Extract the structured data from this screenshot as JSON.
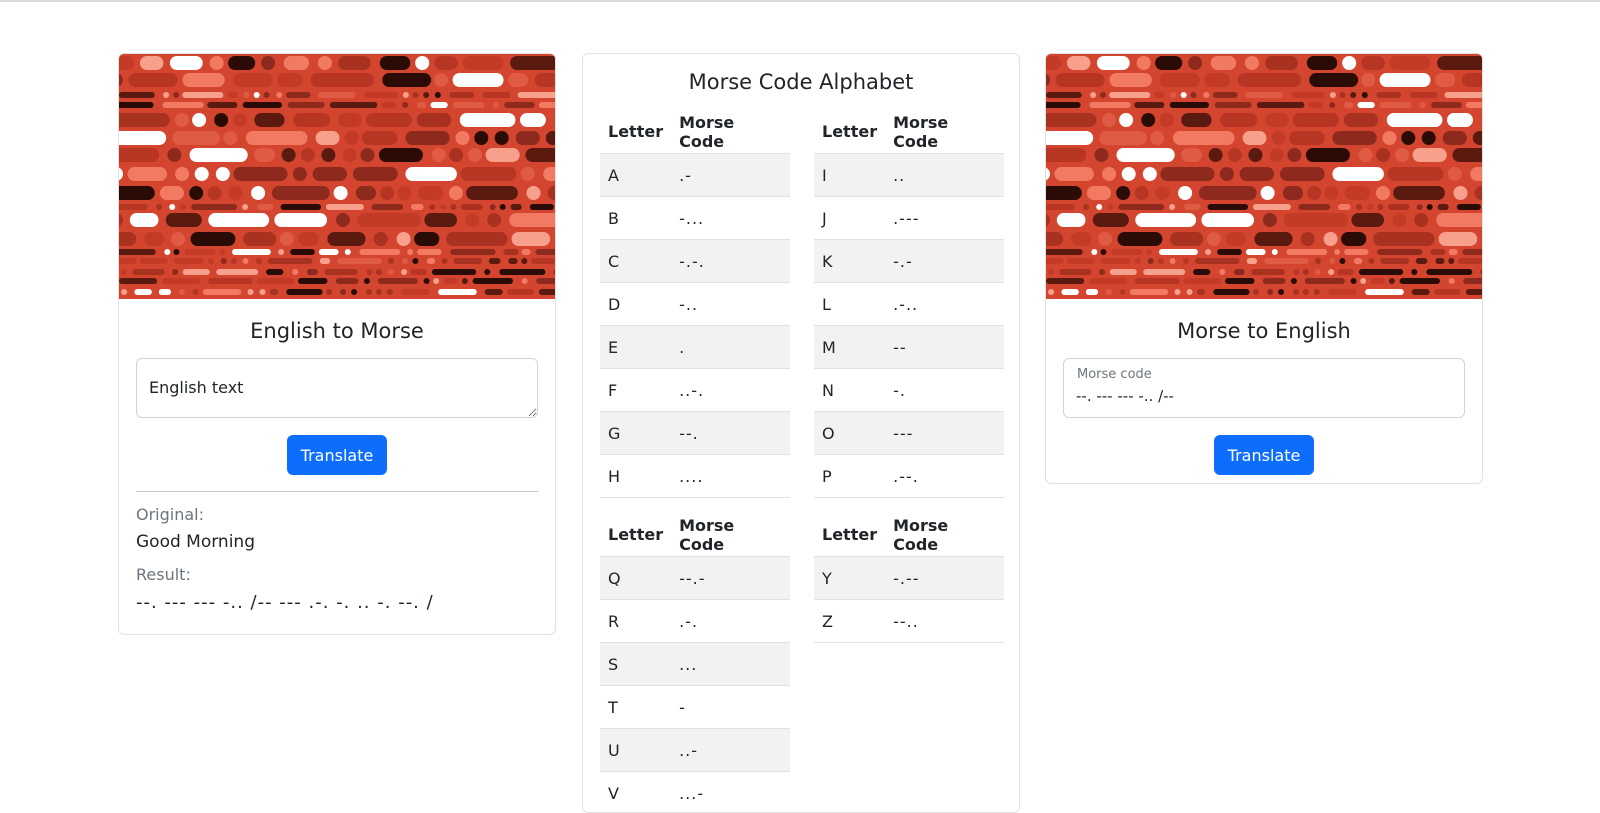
{
  "colors": {
    "accent": "#0d6efd",
    "banner_base": "#d4452f",
    "muted": "#6c757d"
  },
  "left": {
    "title": "English to Morse",
    "input_value": "English text",
    "button_label": "Translate",
    "original_label": "Original:",
    "original_value": "Good Morning",
    "result_label": "Result:",
    "result_value": "--. --- --- -.. /-- --- .-. -. .. -. --. /"
  },
  "middle": {
    "title": "Morse Code Alphabet",
    "header_letter": "Letter",
    "header_code": "Morse Code",
    "tables": [
      {
        "rows": [
          [
            "A",
            ".-"
          ],
          [
            "B",
            "-..."
          ],
          [
            "C",
            "-.-."
          ],
          [
            "D",
            "-.."
          ],
          [
            "E",
            "."
          ],
          [
            "F",
            "..-."
          ],
          [
            "G",
            "--."
          ],
          [
            "H",
            "...."
          ]
        ]
      },
      {
        "rows": [
          [
            "I",
            ".."
          ],
          [
            "J",
            ".---"
          ],
          [
            "K",
            "-.-"
          ],
          [
            "L",
            ".-.."
          ],
          [
            "M",
            "--"
          ],
          [
            "N",
            "-."
          ],
          [
            "O",
            "---"
          ],
          [
            "P",
            ".--."
          ]
        ]
      },
      {
        "rows": [
          [
            "Q",
            "--.-"
          ],
          [
            "R",
            ".-."
          ],
          [
            "S",
            "..."
          ],
          [
            "T",
            "-"
          ],
          [
            "U",
            "..-"
          ],
          [
            "V",
            "...-"
          ]
        ]
      },
      {
        "rows": [
          [
            "Y",
            "-.--"
          ],
          [
            "Z",
            "--.."
          ]
        ]
      }
    ]
  },
  "right": {
    "title": "Morse to English",
    "input_label": "Morse code",
    "input_value": "--. --- --- -.. /--",
    "button_label": "Translate"
  }
}
